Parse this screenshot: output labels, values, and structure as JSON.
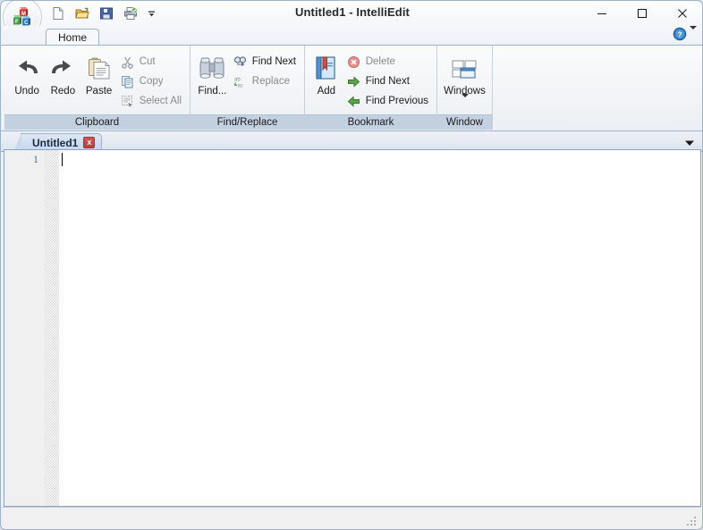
{
  "window": {
    "title": "Untitled1 - IntelliEdit",
    "app_icon": "mfc-blocks-icon",
    "controls": {
      "minimize": "minimize-icon",
      "maximize": "maximize-icon",
      "close": "close-icon"
    }
  },
  "quick_access": {
    "items": [
      {
        "name": "new-icon",
        "label": "New"
      },
      {
        "name": "open-icon",
        "label": "Open"
      },
      {
        "name": "save-icon",
        "label": "Save"
      },
      {
        "name": "print-icon",
        "label": "Print"
      }
    ],
    "customize_label": "Customize Quick Access Toolbar"
  },
  "ribbon": {
    "tab_label": "Home",
    "help_label": "Help",
    "groups": [
      {
        "caption": "Clipboard",
        "big_buttons": [
          {
            "label": "Undo",
            "icon": "undo-icon"
          },
          {
            "label": "Redo",
            "icon": "redo-icon"
          },
          {
            "label": "Paste",
            "icon": "paste-icon"
          }
        ],
        "small_buttons": [
          {
            "label": "Cut",
            "icon": "cut-icon",
            "disabled": true
          },
          {
            "label": "Copy",
            "icon": "copy-icon",
            "disabled": true
          },
          {
            "label": "Select All",
            "icon": "select-all-icon",
            "disabled": true
          }
        ]
      },
      {
        "caption": "Find/Replace",
        "big_buttons": [
          {
            "label": "Find...",
            "icon": "binoculars-icon"
          }
        ],
        "small_buttons": [
          {
            "label": "Find Next",
            "icon": "find-next-icon",
            "disabled": false
          },
          {
            "label": "Replace",
            "icon": "replace-icon",
            "disabled": true
          }
        ]
      },
      {
        "caption": "Bookmark",
        "big_buttons": [
          {
            "label": "Add",
            "icon": "bookmark-add-icon"
          }
        ],
        "small_buttons": [
          {
            "label": "Delete",
            "icon": "delete-icon",
            "disabled": true
          },
          {
            "label": "Find Next",
            "icon": "arrow-right-green-icon",
            "disabled": false
          },
          {
            "label": "Find Previous",
            "icon": "arrow-left-green-icon",
            "disabled": false
          }
        ]
      },
      {
        "caption": "Window",
        "big_buttons": [
          {
            "label": "Windows",
            "icon": "windows-tile-icon",
            "has_dropdown": true
          }
        ],
        "small_buttons": []
      }
    ]
  },
  "document_tabs": {
    "tabs": [
      {
        "label": "Untitled1",
        "close_label": "x",
        "active": true
      }
    ],
    "more_label": "Tab list"
  },
  "editor": {
    "line_numbers": [
      "1"
    ],
    "content": "",
    "caret_visible": true
  },
  "status_bar": {
    "text": ""
  },
  "colors": {
    "accent": "#c3d0e0",
    "tab_active": "#c7d6ec",
    "close_red": "#b8403c",
    "linenum": "#4a6fa5",
    "border": "#9fb2cc"
  }
}
